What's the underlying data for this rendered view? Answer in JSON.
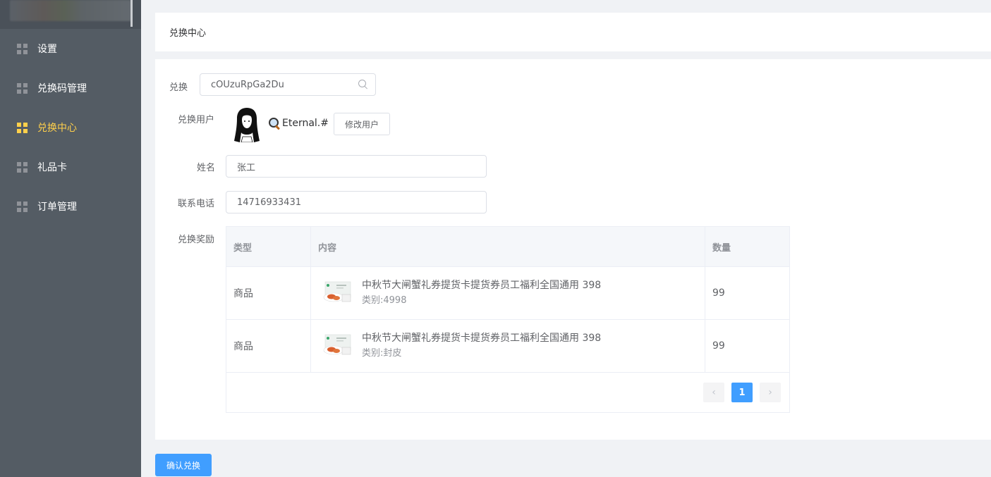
{
  "sidebar": {
    "items": [
      {
        "label": "设置",
        "icon": "grid-icon"
      },
      {
        "label": "兑换码管理",
        "icon": "grid-icon"
      },
      {
        "label": "兑换中心",
        "icon": "grid-icon",
        "active": true
      },
      {
        "label": "礼品卡",
        "icon": "grid-icon"
      },
      {
        "label": "订单管理",
        "icon": "grid-icon"
      }
    ],
    "active_color": "#ffd04b",
    "background": "#545c64"
  },
  "header": {
    "title": "兑换中心"
  },
  "form": {
    "code_label": "兑换",
    "code_value": "cOUzuRpGa2Du",
    "user_label": "兑换用户",
    "user_name": "Eternal.#",
    "change_user_button": "修改用户",
    "name_label": "姓名",
    "name_value": "张工",
    "phone_label": "联系电话",
    "phone_value": "14716933431",
    "reward_label": "兑换奖励"
  },
  "table": {
    "headers": [
      "类型",
      "内容",
      "数量"
    ],
    "rows": [
      {
        "type": "商品",
        "title": "中秋节大闸蟹礼券提货卡提货券员工福利全国通用 398",
        "sub": "类别:4998",
        "qty": "99"
      },
      {
        "type": "商品",
        "title": "中秋节大闸蟹礼券提货卡提货券员工福利全国通用 398",
        "sub": "类别:封皮",
        "qty": "99"
      }
    ]
  },
  "pagination": {
    "prev": "‹",
    "current": "1",
    "next": "›"
  },
  "confirm_button": "确认兑换",
  "primary_color": "#409eff"
}
